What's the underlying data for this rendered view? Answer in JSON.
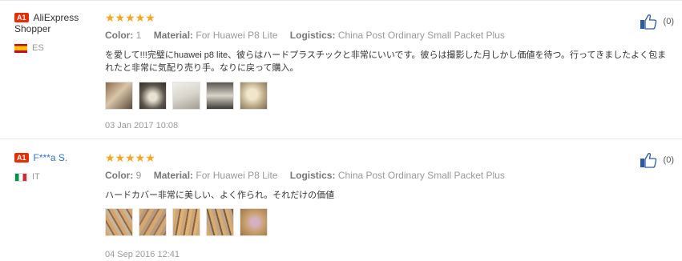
{
  "reviews": [
    {
      "badge": "A1",
      "user": "AliExpress Shopper",
      "country_code": "ES",
      "stars": "★★★★★",
      "color_label": "Color:",
      "color_value": "1",
      "material_label": "Material:",
      "material_value": "For Huawei P8 Lite",
      "logistics_label": "Logistics:",
      "logistics_value": "China Post Ordinary Small Packet Plus",
      "text": "を愛して!!!完璧にhuawei p8 lite、彼らはハードプラスチックと非常にいいです。彼らは撮影した月しかし価値を待つ。行ってきましたよく包まれたと非常に気配り売り手。なりに戻って購入。",
      "photos": [
        "photo-1",
        "photo-2",
        "photo-3",
        "photo-4",
        "photo-5"
      ],
      "date": "03 Jan 2017 10:08",
      "helpful_count": "(0)"
    },
    {
      "badge": "A1",
      "user": "F***a S.",
      "country_code": "IT",
      "stars": "★★★★★",
      "color_label": "Color:",
      "color_value": "9",
      "material_label": "Material:",
      "material_value": "For Huawei P8 Lite",
      "logistics_label": "Logistics:",
      "logistics_value": "China Post Ordinary Small Packet Plus",
      "text": "ハードカバー非常に美しい、よく作られ。それだけの価値",
      "photos": [
        "photo-1",
        "photo-2",
        "photo-3",
        "photo-4",
        "photo-5"
      ],
      "date": "04 Sep 2016 12:41",
      "helpful_count": "(0)"
    }
  ]
}
